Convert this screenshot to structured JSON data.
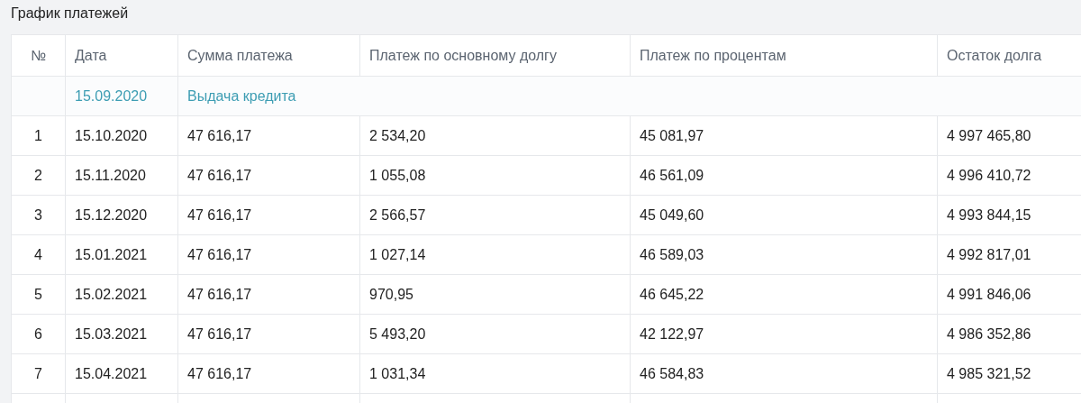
{
  "title": "График платежей",
  "table": {
    "columns": [
      "№",
      "Дата",
      "Сумма платежа",
      "Платеж по основному долгу",
      "Платеж по процентам",
      "Остаток долга"
    ],
    "rows": [
      {
        "kind": "issue",
        "date": "15.09.2020",
        "label": "Выдача кредита"
      },
      {
        "kind": "payment",
        "cells": [
          "1",
          "15.10.2020",
          "47 616,17",
          "2 534,20",
          "45 081,97",
          "4 997 465,80"
        ]
      },
      {
        "kind": "payment",
        "cells": [
          "2",
          "15.11.2020",
          "47 616,17",
          "1 055,08",
          "46 561,09",
          "4 996 410,72"
        ]
      },
      {
        "kind": "payment",
        "cells": [
          "3",
          "15.12.2020",
          "47 616,17",
          "2 566,57",
          "45 049,60",
          "4 993 844,15"
        ]
      },
      {
        "kind": "payment",
        "cells": [
          "4",
          "15.01.2021",
          "47 616,17",
          "1 027,14",
          "46 589,03",
          "4 992 817,01"
        ]
      },
      {
        "kind": "payment",
        "cells": [
          "5",
          "15.02.2021",
          "47 616,17",
          "970,95",
          "46 645,22",
          "4 991 846,06"
        ]
      },
      {
        "kind": "payment",
        "cells": [
          "6",
          "15.03.2021",
          "47 616,17",
          "5 493,20",
          "42 122,97",
          "4 986 352,86"
        ]
      },
      {
        "kind": "payment",
        "cells": [
          "7",
          "15.04.2021",
          "47 616,17",
          "1 031,34",
          "46 584,83",
          "4 985 321,52"
        ]
      }
    ]
  }
}
